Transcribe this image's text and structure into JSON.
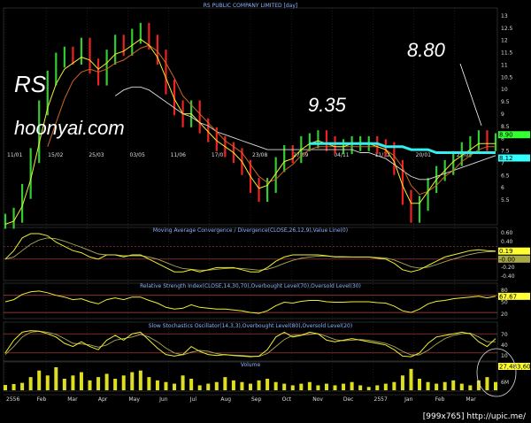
{
  "chart_data": {
    "type": "line",
    "title": "RS PUBLIC COMPANY LIMITED [day]",
    "symbol": "RS",
    "site": "hoonyai.com",
    "annotations": [
      {
        "label": "9.35"
      },
      {
        "label": "8.80"
      }
    ],
    "price": {
      "ylim": [
        6,
        13
      ],
      "yticks": [
        "13",
        "12.5",
        "12",
        "11.5",
        "11",
        "10.5",
        "10",
        "9.5",
        "9",
        "8.5",
        "8",
        "7.5",
        "7",
        "6.5",
        "6",
        "5.5"
      ],
      "close": [
        6.0,
        6.2,
        7.0,
        8.2,
        9.8,
        10.8,
        11.4,
        11.6,
        11.5,
        11.9,
        11.2,
        10.8,
        11.5,
        12.0,
        11.8,
        12.2,
        12.4,
        12.0,
        11.5,
        10.5,
        9.8,
        9.4,
        9.8,
        9.2,
        8.9,
        8.6,
        8.4,
        8.2,
        7.8,
        7.2,
        6.9,
        7.2,
        7.9,
        8.3,
        8.2,
        8.6,
        8.7,
        8.8,
        8.6,
        8.5,
        8.5,
        8.6,
        8.6,
        8.6,
        8.5,
        8.4,
        7.8,
        6.8,
        6.2,
        6.6,
        7.2,
        7.6,
        7.8,
        8.1,
        8.4,
        8.6,
        8.8,
        8.6,
        8.7
      ],
      "ma_fast": [
        5.9,
        6.0,
        6.5,
        7.4,
        8.6,
        9.8,
        10.6,
        11.1,
        11.3,
        11.5,
        11.4,
        11.1,
        11.3,
        11.6,
        11.7,
        11.9,
        12.1,
        11.9,
        11.5,
        10.8,
        10.1,
        9.6,
        9.6,
        9.3,
        9.0,
        8.7,
        8.5,
        8.3,
        8.0,
        7.5,
        7.1,
        7.2,
        7.6,
        8.0,
        8.1,
        8.4,
        8.6,
        8.7,
        8.6,
        8.5,
        8.5,
        8.6,
        8.6,
        8.6,
        8.5,
        8.4,
        8.0,
        7.2,
        6.6,
        6.6,
        7.0,
        7.4,
        7.7,
        8.0,
        8.2,
        8.4,
        8.6,
        8.6,
        8.6
      ],
      "ma_mid": [
        null,
        null,
        null,
        null,
        null,
        8.5,
        9.3,
        10.1,
        10.7,
        11.0,
        11.1,
        11.0,
        11.1,
        11.3,
        11.4,
        11.6,
        11.8,
        11.9,
        11.7,
        11.3,
        10.8,
        10.2,
        9.9,
        9.6,
        9.3,
        9.0,
        8.7,
        8.5,
        8.3,
        7.9,
        7.5,
        7.3,
        7.4,
        7.7,
        7.9,
        8.2,
        8.4,
        8.5,
        8.5,
        8.5,
        8.5,
        8.5,
        8.5,
        8.5,
        8.5,
        8.4,
        8.2,
        7.8,
        7.2,
        6.9,
        7.0,
        7.2,
        7.5,
        7.7,
        8.0,
        8.2,
        8.4,
        8.5,
        8.5
      ],
      "ma_slow": [
        null,
        null,
        null,
        null,
        null,
        null,
        null,
        null,
        null,
        null,
        null,
        null,
        null,
        10.2,
        10.4,
        10.5,
        10.5,
        10.4,
        10.2,
        10.0,
        9.8,
        9.6,
        9.5,
        9.3,
        9.2,
        9.0,
        8.9,
        8.8,
        8.7,
        8.6,
        8.5,
        8.4,
        8.4,
        8.4,
        8.4,
        8.4,
        8.4,
        8.4,
        8.4,
        8.4,
        8.4,
        8.4,
        8.3,
        8.3,
        8.2,
        8.1,
        7.9,
        7.7,
        7.5,
        7.4,
        7.4,
        7.5,
        7.6,
        7.7,
        7.8,
        7.9,
        8.0,
        8.1,
        8.2
      ],
      "resistance": {
        "from": 36,
        "to": 58,
        "values": [
          8.6,
          8.6,
          8.6,
          8.6,
          8.6,
          8.6,
          8.6,
          8.6,
          8.6,
          8.5,
          8.5,
          8.5,
          8.4,
          8.4,
          8.4,
          8.3,
          8.3,
          8.3,
          8.3,
          8.3,
          8.3,
          8.3,
          8.3
        ]
      },
      "badges": [
        {
          "label": "8.90",
          "value": 8.9,
          "color": "#3f3"
        },
        {
          "label": "8.12",
          "value": 8.12,
          "color": "#3ff"
        }
      ]
    },
    "macd": {
      "title": "Moving Average Convergence / Divergence(CLOSE,26,12,9),Value Line(0)",
      "ylim": [
        -0.4,
        0.6
      ],
      "yticks": [
        "0.60",
        "0.40",
        "0.20",
        "0.00",
        "-0.20",
        "-0.40"
      ],
      "macd": [
        0.0,
        0.2,
        0.5,
        0.6,
        0.6,
        0.55,
        0.4,
        0.3,
        0.2,
        0.15,
        0.05,
        0.0,
        0.1,
        0.1,
        0.05,
        0.1,
        0.1,
        0.0,
        -0.1,
        -0.2,
        -0.3,
        -0.3,
        -0.25,
        -0.3,
        -0.25,
        -0.2,
        -0.2,
        -0.2,
        -0.25,
        -0.3,
        -0.3,
        -0.2,
        -0.05,
        0.05,
        0.1,
        0.1,
        0.1,
        0.1,
        0.08,
        0.05,
        0.05,
        0.05,
        0.05,
        0.05,
        0.02,
        0.0,
        -0.1,
        -0.25,
        -0.3,
        -0.25,
        -0.15,
        -0.05,
        0.05,
        0.1,
        0.15,
        0.2,
        0.22,
        0.2,
        0.19
      ],
      "signal": [
        0.0,
        0.05,
        0.2,
        0.35,
        0.45,
        0.5,
        0.48,
        0.42,
        0.35,
        0.28,
        0.2,
        0.12,
        0.1,
        0.1,
        0.08,
        0.08,
        0.08,
        0.05,
        0.0,
        -0.08,
        -0.16,
        -0.22,
        -0.24,
        -0.26,
        -0.26,
        -0.24,
        -0.22,
        -0.21,
        -0.22,
        -0.24,
        -0.26,
        -0.24,
        -0.18,
        -0.1,
        -0.03,
        0.02,
        0.05,
        0.07,
        0.07,
        0.06,
        0.06,
        0.05,
        0.05,
        0.05,
        0.04,
        0.03,
        -0.02,
        -0.1,
        -0.18,
        -0.21,
        -0.19,
        -0.13,
        -0.06,
        0.0,
        0.06,
        0.11,
        0.15,
        0.17,
        0.18
      ],
      "badges": [
        {
          "label": "0.19",
          "value": 0.19,
          "color": "#ff3"
        },
        {
          "label": "-0.00",
          "value": 0.0,
          "color": "#aa4"
        }
      ]
    },
    "rsi": {
      "title": "Relative Strength Index(CLOSE,14,30,70),Overbought Level(70),Oversold Level(30)",
      "ylim": [
        20,
        90
      ],
      "yticks": [
        "80",
        "50",
        "20"
      ],
      "overbought": 70,
      "oversold": 30,
      "values": [
        55,
        60,
        72,
        78,
        80,
        76,
        70,
        66,
        60,
        62,
        55,
        50,
        60,
        64,
        60,
        66,
        66,
        58,
        52,
        42,
        38,
        40,
        48,
        42,
        40,
        38,
        38,
        36,
        34,
        30,
        28,
        34,
        46,
        54,
        52,
        56,
        58,
        58,
        55,
        54,
        54,
        55,
        55,
        55,
        53,
        52,
        45,
        34,
        30,
        38,
        50,
        56,
        58,
        62,
        64,
        66,
        68,
        64,
        67.67
      ],
      "badges": [
        {
          "label": "67.67",
          "value": 67.67,
          "color": "#ff3"
        }
      ]
    },
    "stoch": {
      "title": "Slow Stochastics Oscillator(14,3,3),Overbought Level(80),Oversold Level(20)",
      "ylim": [
        0,
        100
      ],
      "yticks": [
        "70",
        "40",
        "10"
      ],
      "overbought": 80,
      "oversold": 20,
      "k": [
        20,
        60,
        85,
        90,
        88,
        80,
        70,
        50,
        40,
        55,
        40,
        30,
        60,
        75,
        60,
        80,
        85,
        60,
        35,
        15,
        10,
        15,
        40,
        25,
        15,
        12,
        15,
        12,
        10,
        8,
        10,
        30,
        70,
        85,
        70,
        75,
        85,
        80,
        60,
        55,
        60,
        65,
        60,
        55,
        50,
        45,
        30,
        10,
        8,
        20,
        50,
        70,
        75,
        80,
        85,
        80,
        55,
        40,
        65
      ],
      "d": [
        15,
        40,
        70,
        85,
        88,
        85,
        78,
        65,
        50,
        48,
        45,
        38,
        45,
        60,
        65,
        70,
        78,
        70,
        55,
        35,
        20,
        14,
        22,
        28,
        25,
        18,
        14,
        13,
        12,
        10,
        9,
        18,
        40,
        62,
        75,
        76,
        78,
        80,
        72,
        62,
        58,
        60,
        62,
        60,
        55,
        50,
        40,
        25,
        14,
        14,
        28,
        48,
        65,
        75,
        80,
        82,
        70,
        55,
        55
      ]
    },
    "volume": {
      "title": "Volume",
      "ylim": [
        0,
        27483600
      ],
      "yticks": [
        "6M"
      ],
      "badges": [
        {
          "label": "27,483,600",
          "value": 27483600,
          "color": "#ff3"
        }
      ],
      "values": [
        3.2,
        3.8,
        4.5,
        8,
        12,
        9,
        14,
        7,
        9,
        11,
        6,
        8,
        10,
        7,
        9,
        11,
        12,
        8,
        6,
        5,
        4,
        9,
        7,
        3,
        4,
        5,
        8,
        6,
        5,
        4,
        6,
        7,
        5,
        4,
        3,
        4,
        5,
        3,
        4,
        3,
        4,
        5,
        3,
        2,
        3,
        4,
        5,
        9,
        13,
        7,
        5,
        4,
        5,
        6,
        4,
        3,
        6,
        8,
        5
      ]
    },
    "x_axis": {
      "top_labels": [
        "11/01",
        "15/02",
        "25/03",
        "03/05",
        "11/06",
        "17/07",
        "23/08",
        "27/09",
        "04/11",
        "11/12",
        "20/01",
        "25/02"
      ],
      "bottom_labels": [
        "2556",
        "Feb",
        "Mar",
        "Apr",
        "May",
        "Jun",
        "Jul",
        "Aug",
        "Sep",
        "Oct",
        "Nov",
        "Dec",
        "2557",
        "Jan",
        "Feb",
        "Mar"
      ]
    },
    "footer": "[999x765] http://upic.me/"
  }
}
